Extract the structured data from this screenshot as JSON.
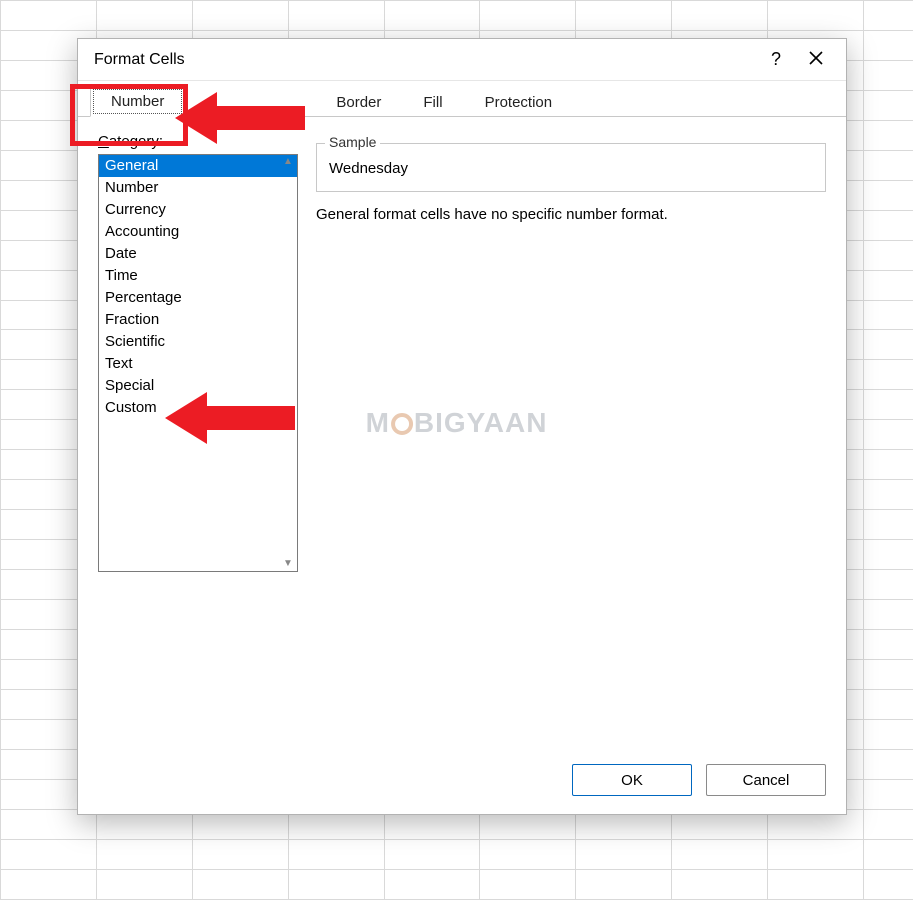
{
  "dialog": {
    "title": "Format Cells",
    "help_symbol": "?",
    "tabs": [
      {
        "label": "Number",
        "active": true
      },
      {
        "label": "Border",
        "active": false
      },
      {
        "label": "Fill",
        "active": false
      },
      {
        "label": "Protection",
        "active": false
      }
    ],
    "category_label_pre": "C",
    "category_label_rest": "ategory:",
    "categories": [
      {
        "label": "General",
        "selected": true
      },
      {
        "label": "Number"
      },
      {
        "label": "Currency"
      },
      {
        "label": "Accounting"
      },
      {
        "label": "Date"
      },
      {
        "label": "Time"
      },
      {
        "label": "Percentage"
      },
      {
        "label": "Fraction"
      },
      {
        "label": "Scientific"
      },
      {
        "label": "Text"
      },
      {
        "label": "Special"
      },
      {
        "label": "Custom"
      }
    ],
    "sample_legend": "Sample",
    "sample_value": "Wednesday",
    "description": "General format cells have no specific number format.",
    "ok_label": "OK",
    "cancel_label": "Cancel"
  },
  "watermark": {
    "pre": "M",
    "post": "BIGYAAN"
  },
  "annotations": {
    "arrow1_target": "number-tab",
    "arrow2_target": "custom-category"
  }
}
